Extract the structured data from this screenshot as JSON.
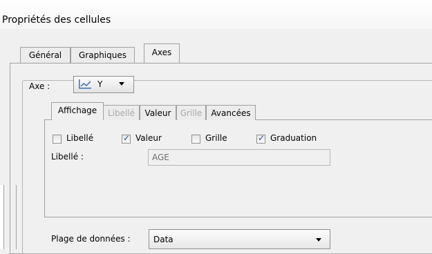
{
  "window": {
    "title": "Propriétés des cellules"
  },
  "tabs": [
    {
      "label": "Général"
    },
    {
      "label": "Graphiques"
    },
    {
      "label": "Axes"
    }
  ],
  "axis_group": {
    "label": "Axe :",
    "selected_axis": "Y",
    "icon": "line-chart-icon"
  },
  "inner_tabs": [
    {
      "label": "Affichage"
    },
    {
      "label": "Libellé"
    },
    {
      "label": "Valeur"
    },
    {
      "label": "Grille"
    },
    {
      "label": "Avancées"
    }
  ],
  "options": [
    {
      "label": "Libellé",
      "checked": false
    },
    {
      "label": "Valeur",
      "checked": true
    },
    {
      "label": "Grille",
      "checked": false
    },
    {
      "label": "Graduation",
      "checked": true
    }
  ],
  "libelle_field": {
    "label": "Libellé :",
    "value": "AGE"
  },
  "data_range": {
    "label": "Plage de données :",
    "value": "Data"
  },
  "colors": {
    "check": "#2a4d9a",
    "disabled": "#a9a9a9"
  }
}
